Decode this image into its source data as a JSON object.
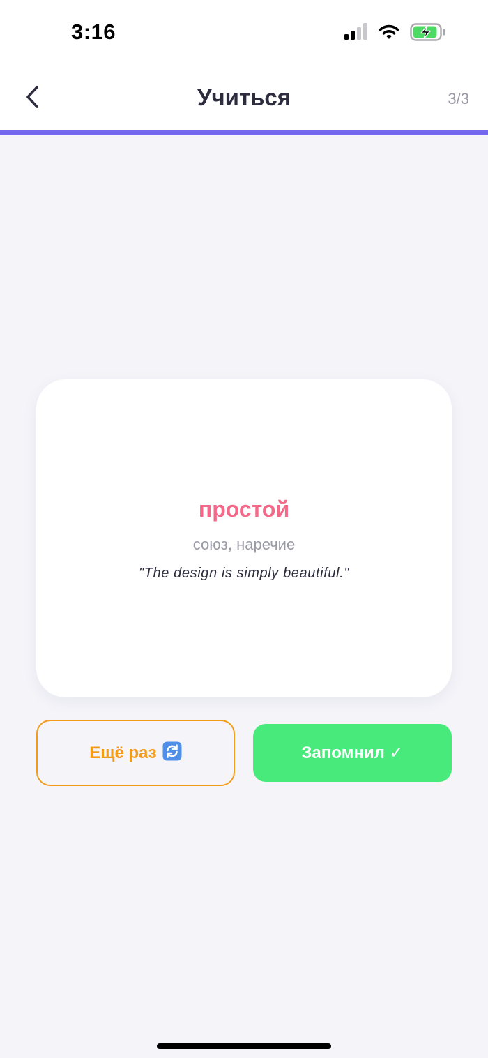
{
  "status_bar": {
    "time": "3:16",
    "icons": [
      "cellular-signal-icon",
      "wifi-icon",
      "battery-charging-icon"
    ]
  },
  "nav": {
    "back_icon": "chevron-left-icon",
    "title": "Учиться",
    "counter": "3/3",
    "progress_fraction": 1.0
  },
  "card": {
    "word": "простой",
    "part_of_speech": "союз, наречие",
    "example": "\"The design is simply beautiful.\""
  },
  "actions": {
    "again_label": "Ещё раз",
    "again_icon": "repeat-icon",
    "done_label": "Запомнил ✓"
  },
  "colors": {
    "accent": "#7468f0",
    "word": "#f4698a",
    "again": "#f39c1a",
    "done": "#47ea7b",
    "battery": "#4cd964"
  }
}
